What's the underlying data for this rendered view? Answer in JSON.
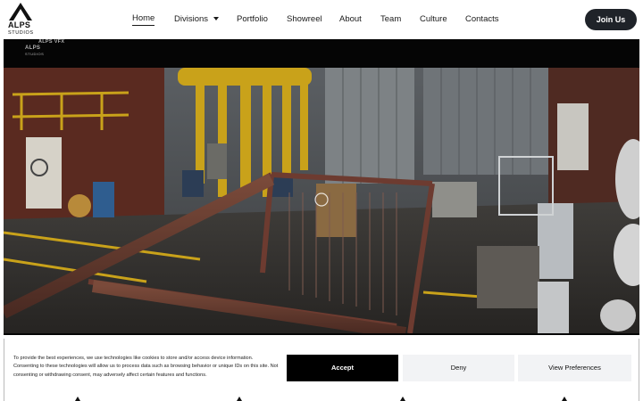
{
  "brand": {
    "name": "ALPS",
    "sub": "STUDIOS"
  },
  "nav": {
    "items": [
      {
        "label": "Home"
      },
      {
        "label": "Divisions"
      },
      {
        "label": "Portfolio"
      },
      {
        "label": "Showreel"
      },
      {
        "label": "About"
      },
      {
        "label": "Team"
      },
      {
        "label": "Culture"
      },
      {
        "label": "Contacts"
      }
    ],
    "join_label": "Join Us"
  },
  "video": {
    "watermark_title": "ALPS VFX",
    "watermark_main": "ALPS",
    "watermark_sub": "STUDIOS"
  },
  "cookie": {
    "text": "To provide the best experiences, we use technologies like cookies to store and/or access device information. Consenting to these technologies will allow us to process data such as browsing behavior or unique IDs on this site. Not consenting or withdrawing consent, may adversely affect certain features and functions.",
    "accept": "Accept",
    "deny": "Deny",
    "preferences": "View Preferences"
  },
  "colors": {
    "button_dark": "#1f2329",
    "accept_bg": "#000000",
    "secondary_bg": "#f2f3f5"
  }
}
